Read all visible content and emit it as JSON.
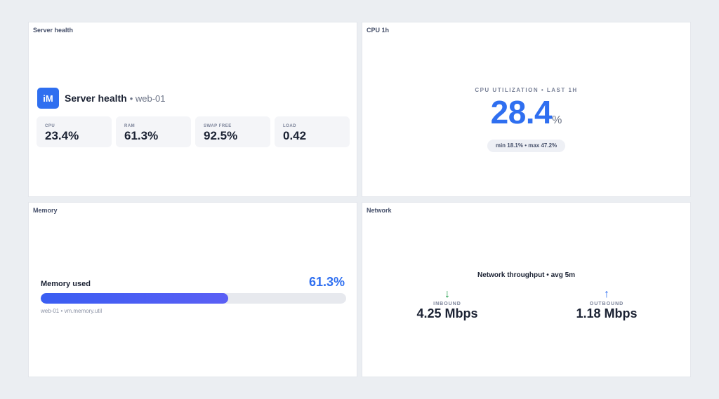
{
  "panels": {
    "server": {
      "title": "Server health"
    },
    "cpu": {
      "title": "CPU 1h"
    },
    "memory": {
      "title": "Memory"
    },
    "network": {
      "title": "Network"
    }
  },
  "server_health": {
    "logo_text": "iM",
    "title": "Server health",
    "host": "• web-01",
    "tiles": [
      {
        "label": "CPU",
        "value": "23.4%"
      },
      {
        "label": "RAM",
        "value": "61.3%"
      },
      {
        "label": "SWAP FREE",
        "value": "92.5%"
      },
      {
        "label": "LOAD",
        "value": "0.42"
      }
    ]
  },
  "cpu": {
    "caption": "CPU UTILIZATION • LAST 1H",
    "value": "28.4",
    "unit": "%",
    "range": "min 18.1% • max 47.2%"
  },
  "memory": {
    "label": "Memory used",
    "value": "61.3%",
    "fill_fraction": 0.613,
    "caption": "web-01 • vm.memory.util"
  },
  "network": {
    "title": "Network throughput • avg 5m",
    "inbound": {
      "arrow": "↓",
      "label": "INBOUND",
      "value": "4.25 Mbps",
      "color": "#1f9d4a"
    },
    "outbound": {
      "arrow": "↑",
      "label": "OUTBOUND",
      "value": "1.18 Mbps",
      "color": "#2f6ff0"
    }
  },
  "colors": {
    "accent": "#2f6ff0",
    "background": "#ebeef2"
  }
}
